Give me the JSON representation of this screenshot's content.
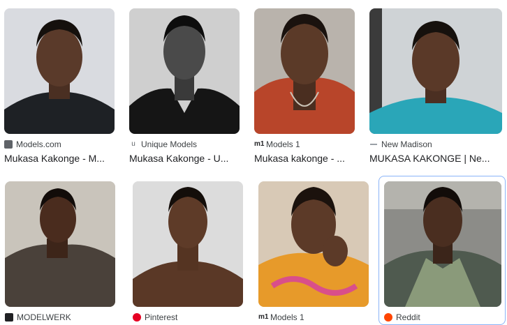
{
  "results": [
    {
      "source": "Models.com",
      "title": "Mukasa Kakonge - M...",
      "favicon": "models-com-icon"
    },
    {
      "source": "Unique Models",
      "title": "Mukasa Kakonge - U...",
      "favicon": "unique-models-icon"
    },
    {
      "source": "Models 1",
      "title": "Mukasa kakonge - ...",
      "favicon": "models1-icon"
    },
    {
      "source": "New Madison",
      "title": "MUKASA KAKONGE | Ne...",
      "favicon": "new-madison-icon"
    },
    {
      "source": "MODELWERK",
      "title": "",
      "favicon": "modelwerk-icon"
    },
    {
      "source": "Pinterest",
      "title": "",
      "favicon": "pinterest-icon"
    },
    {
      "source": "Models 1",
      "title": "",
      "favicon": "models1-icon"
    },
    {
      "source": "Reddit",
      "title": "",
      "favicon": "reddit-icon"
    }
  ],
  "colors": {
    "selected_border": "#8ab4f8",
    "pinterest": "#e60023",
    "reddit": "#ff4500"
  }
}
